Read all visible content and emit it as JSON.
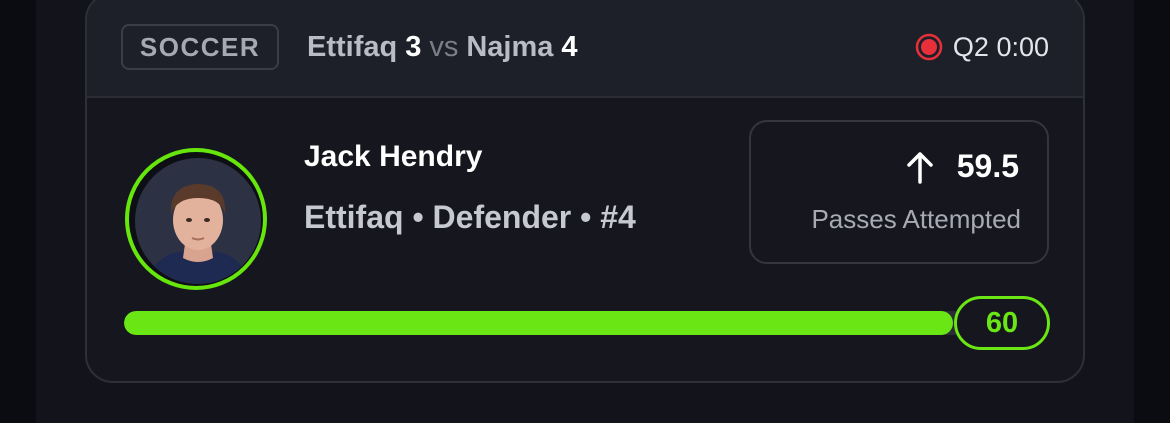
{
  "card": {
    "header": {
      "sport": "SOCCER",
      "home_team": "Ettifaq",
      "home_score": "3",
      "vs": "vs",
      "away_team": "Najma",
      "away_score": "4",
      "live_icon": "live-record-icon",
      "clock": "Q2 0:00"
    },
    "player": {
      "name": "Jack Hendry",
      "meta": "Ettifaq • Defender • #4",
      "avatar": "player-headshot"
    },
    "stat": {
      "direction_icon": "arrow-up-icon",
      "line": "59.5",
      "label": "Passes Attempted"
    },
    "progress": {
      "current_value": "60",
      "fill_fraction": 0.985
    }
  },
  "colors": {
    "accent_green": "#6ae614",
    "live_red": "#e8303a",
    "card_bg": "#15161e",
    "header_bg": "#1e2029"
  }
}
